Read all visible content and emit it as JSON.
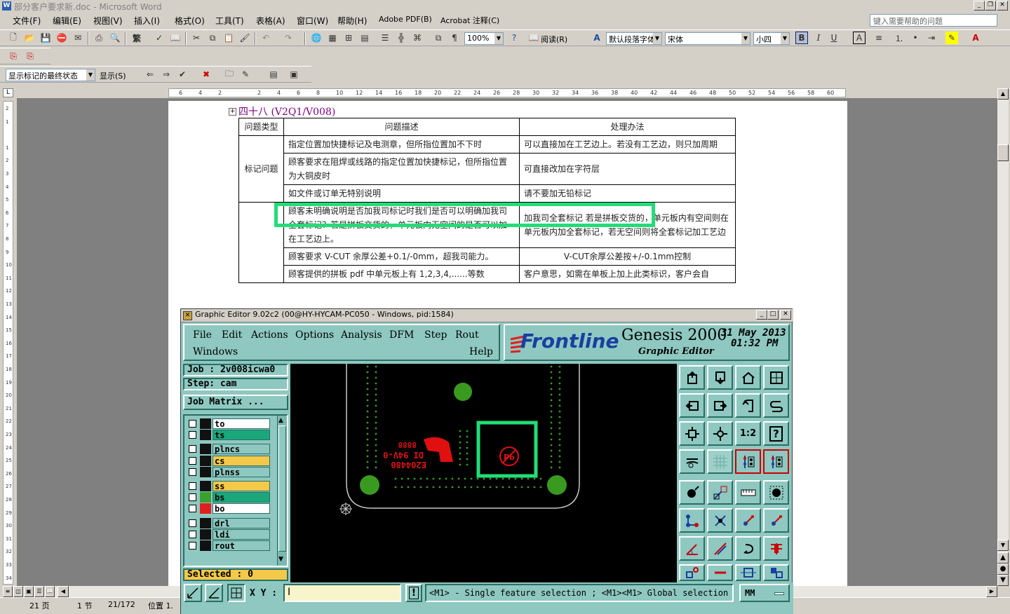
{
  "word": {
    "title": "部分客户要求新.doc - Microsoft Word",
    "menu": [
      "文件(F)",
      "编辑(E)",
      "视图(V)",
      "插入(I)",
      "格式(O)",
      "工具(T)",
      "表格(A)",
      "窗口(W)",
      "帮助(H)",
      "Adobe PDF(B)",
      "Acrobat 注释(C)"
    ],
    "help_placeholder": "键入需要帮助的问题",
    "zoom": "100%",
    "read_label": "阅读(R)",
    "style": "默认段落字体",
    "font": "宋体",
    "size": "小四",
    "markup_state": "显示标记的最终状态",
    "show_label": "显示(S)",
    "ruler_ticks": [
      "6",
      "4",
      "2",
      "",
      "2",
      "4",
      "6",
      "8",
      "10",
      "12",
      "14",
      "16",
      "18",
      "20",
      "22",
      "24",
      "26",
      "28",
      "30",
      "32",
      "34",
      "36",
      "38",
      "40",
      "42",
      "44",
      "46",
      "48",
      "50",
      "52",
      "54",
      "56",
      "58",
      "60"
    ],
    "vruler_ticks": [
      "2",
      "1",
      "",
      "1",
      "2",
      "3",
      "4",
      "5",
      "6",
      "7",
      "8",
      "9",
      "10",
      "11",
      "12",
      "13",
      "14",
      "15",
      "16",
      "17",
      "18",
      "19",
      "20",
      "21",
      "22",
      "23",
      "24",
      "25",
      "26",
      "27",
      "28",
      "29",
      "30",
      "31",
      "32",
      "33",
      "34"
    ],
    "doc": {
      "section_title": "四十八  (V2Q1/V008)",
      "headers": [
        "问题类型",
        "问题描述",
        "处理办法"
      ],
      "category_1": "标记问题",
      "rows": [
        {
          "desc": "指定位置加快捷标记及电测章，但所指位置加不下时",
          "action": "可以直接加在工艺边上。若没有工艺边，则只加周期"
        },
        {
          "desc": "顾客要求在阻焊或线路的指定位置加快捷标记，但所指位置为大铜皮时",
          "action": "可直接改加在字符层"
        },
        {
          "desc": "如文件或订单无特别说明",
          "action": "请不要加无铅标记"
        },
        {
          "desc": "顾客未明确说明是否加我司标记时我们是否可以明确加我司全套标记？若是拼板交货的，单元板内无空间的是否可以加在工艺边上。",
          "action": "加我司全套标记 若是拼板交货的，单元板内有空间则在单元板内加全套标记，若无空间则将全套标记加工艺边"
        },
        {
          "desc": "顾客要求 V-CUT 余厚公差+0.1/-0mm，超我司能力。",
          "action": "V-CUT余厚公差按+/-0.1mm控制"
        },
        {
          "desc": "顾客提供的拼板 pdf 中单元板上有 1,2,3,4,......等数",
          "action": "客户意思，如需在单板上加上此类标识，客户会自"
        }
      ]
    },
    "status": {
      "page": "21 页",
      "section": "1 节",
      "pages": "21/172",
      "pos": "位置 1."
    }
  },
  "genesis": {
    "title": "Graphic Editor 9.02c2 (00@HY-HYCAM-PC050 - Windows, pid:1584)",
    "menu": [
      "File",
      "Edit",
      "Actions",
      "Options",
      "Analysis",
      "DFM",
      "Step",
      "Rout",
      "Windows",
      "Help"
    ],
    "brand": "Frontline",
    "product": "Genesis 2000",
    "subtitle": "Graphic Editor",
    "date": "31 May 2013",
    "time": "01:32 PM",
    "job": "Job : 2v008icwa0",
    "step": "Step: cam",
    "job_matrix": "Job Matrix ...",
    "layers": [
      {
        "name": "to",
        "color": "#ffffff",
        "swatch": "#111111"
      },
      {
        "name": "ts",
        "color": "#1aa87a",
        "swatch": "#111111"
      },
      {
        "name": "plncs",
        "color": "#8ec8c0",
        "swatch": "#111111"
      },
      {
        "name": "cs",
        "color": "#f4c848",
        "swatch": "#111111"
      },
      {
        "name": "plnss",
        "color": "#8ec8c0",
        "swatch": "#111111"
      },
      {
        "name": "ss",
        "color": "#f4c848",
        "swatch": "#111111"
      },
      {
        "name": "bs",
        "color": "#1aa87a",
        "swatch": "#3aa030"
      },
      {
        "name": "bo",
        "color": "#ffffff",
        "swatch": "#e02020"
      },
      {
        "name": "drl",
        "color": "#8ec8c0",
        "swatch": "#111111"
      },
      {
        "name": "ldi",
        "color": "#8ec8c0",
        "swatch": "#111111"
      },
      {
        "name": "rout",
        "color": "#8ec8c0",
        "swatch": "#111111"
      }
    ],
    "selected": "Selected : 0",
    "xy_label": "X Y :",
    "hint": "<M1> - Single feature selection ; <M1><M1> Global selection",
    "units": "MM",
    "silk_text": [
      "E204480",
      "DI 94V-0",
      "8888"
    ],
    "colors": {
      "bg": "#8ec8c0",
      "accent": "#22dd77",
      "copper": "#3a9a20",
      "silk": "#e01010"
    }
  }
}
